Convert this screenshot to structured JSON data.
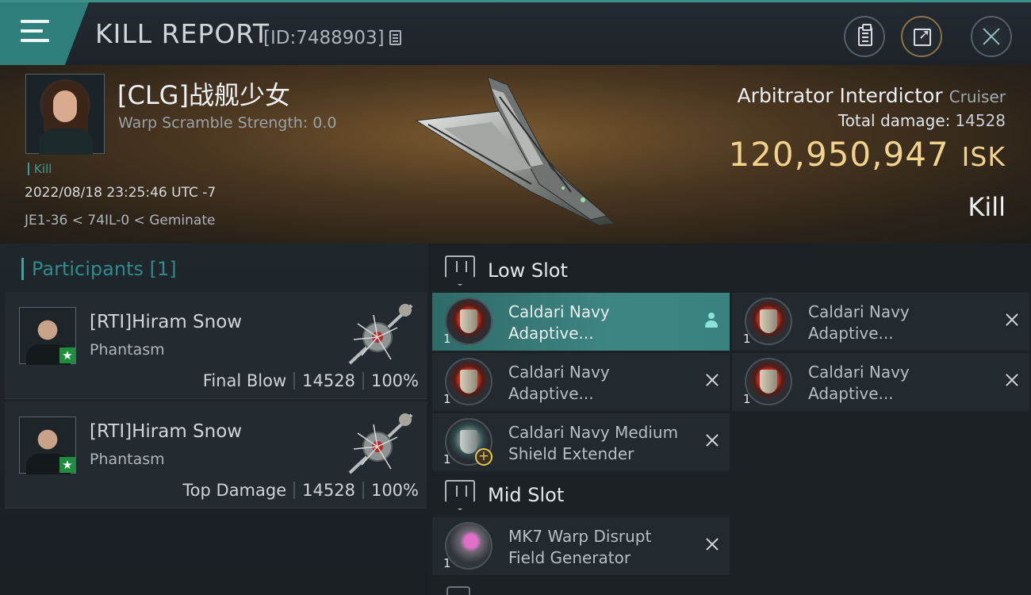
{
  "header": {
    "title": "KILL REPORT",
    "report_id": "[ID:7488903]"
  },
  "victim": {
    "name": "[CLG]战舰少女",
    "warp_scramble": "Warp Scramble Strength: 0.0",
    "tag": "Kill",
    "datetime": "2022/08/18 23:25:46 UTC -7",
    "location": "JE1-36 < 74IL-0 < Geminate",
    "ship_name": "Arbitrator Interdictor",
    "ship_class": "Cruiser",
    "total_damage_label": "Total damage:",
    "total_damage": "14528",
    "isk_value": "120,950,947",
    "isk_unit": "ISK",
    "result": "Kill"
  },
  "participants": {
    "header": "Participants [1]",
    "items": [
      {
        "name": "[RTI]Hiram Snow",
        "ship": "Phantasm",
        "role": "Final Blow",
        "damage": "14528",
        "percent": "100%"
      },
      {
        "name": "[RTI]Hiram Snow",
        "ship": "Phantasm",
        "role": "Top Damage",
        "damage": "14528",
        "percent": "100%"
      }
    ]
  },
  "fitting": {
    "low_slot_title": "Low Slot",
    "mid_slot_title": "Mid Slot",
    "low": [
      {
        "qty": "1",
        "line1": "Caldari Navy",
        "line2": "Adaptive..."
      },
      {
        "qty": "1",
        "line1": "Caldari Navy",
        "line2": "Adaptive..."
      },
      {
        "qty": "1",
        "line1": "Caldari Navy",
        "line2": "Adaptive..."
      },
      {
        "qty": "1",
        "line1": "Caldari Navy",
        "line2": "Adaptive..."
      },
      {
        "qty": "1",
        "line1": "Caldari Navy Medium",
        "line2": "Shield Extender"
      }
    ],
    "mid": [
      {
        "qty": "1",
        "line1": "MK7 Warp Disrupt",
        "line2": "Field Generator"
      }
    ]
  },
  "colors": {
    "accent": "#3f9c98",
    "isk": "#f2d38e",
    "selected_row": "#3d8583"
  }
}
